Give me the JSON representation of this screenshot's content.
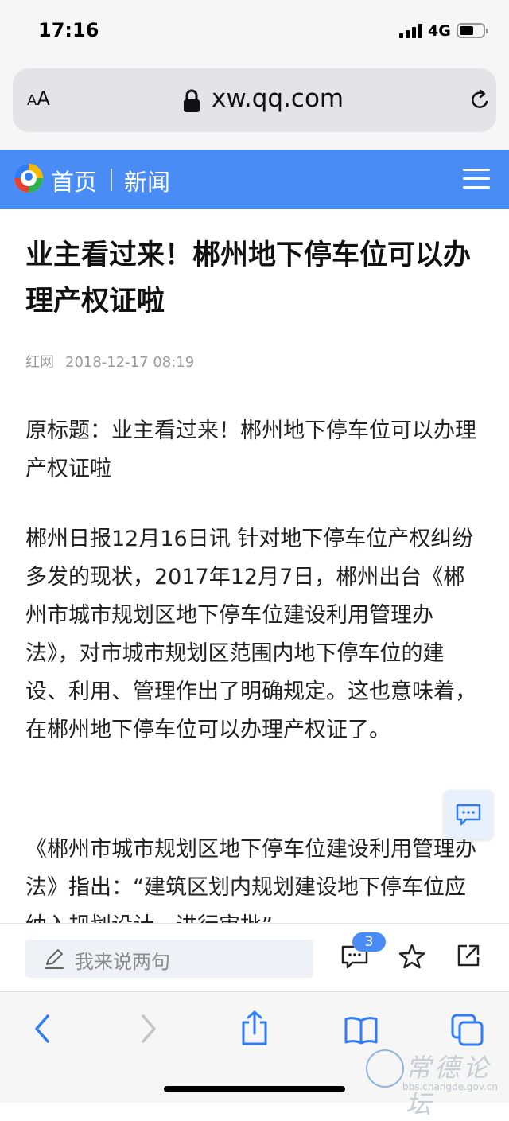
{
  "status": {
    "time": "17:16",
    "network": "4G"
  },
  "browser": {
    "aa_label_small": "A",
    "aa_label_big": "A",
    "url": "xw.qq.com"
  },
  "nav": {
    "home": "首页",
    "section": "新闻"
  },
  "article": {
    "title": "业主看过来！郴州地下停车位可以办理产权证啦",
    "source": "红网",
    "datetime": "2018-12-17 08:19",
    "paragraphs": [
      "原标题：业主看过来！郴州地下停车位可以办理产权证啦",
      "郴州日报12月16日讯 针对地下停车位产权纠纷多发的现状，2017年12月7日，郴州出台《郴州市城市规划区地下停车位建设利用管理办法》，对市城市规划区范围内地下停车位的建设、利用、管理作出了明确规定。这也意味着，在郴州地下停车位可以办理产权证了。",
      "《郴州市城市规划区地下停车位建设利用管理办法》指出：“建筑区划内规划建设地下停车位应纳入规划设计，进行审批”"
    ]
  },
  "comment_bar": {
    "placeholder": "我来说两句",
    "comment_count": "3"
  },
  "watermark": {
    "name": "常德论坛",
    "url": "bbs.changde.gov.cn"
  },
  "colors": {
    "nav_blue": "#4a8cf5",
    "safari_blue": "#2f7cf6"
  }
}
